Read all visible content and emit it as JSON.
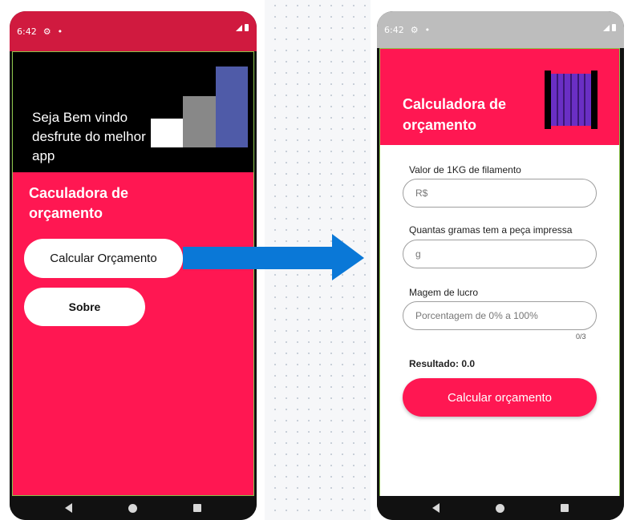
{
  "screen1": {
    "status_time": "6:42",
    "welcome": "Seja Bem vindo desfrute do melhor app",
    "title": "Caculadora de orçamento",
    "buttons": {
      "calc": "Calcular Orçamento",
      "sobre": "Sobre"
    }
  },
  "screen2": {
    "status_time": "6:42",
    "title": "Calculadora de orçamento",
    "fields": {
      "valor": {
        "label": "Valor de 1KG de filamento",
        "placeholder": "R$"
      },
      "gramas": {
        "label": "Quantas gramas tem a peça impressa",
        "placeholder": "g"
      },
      "lucro": {
        "label": "Magem de lucro",
        "placeholder": "Porcentagem de 0% a 100%",
        "counter": "0/3"
      }
    },
    "result": "Resultado: 0.0",
    "button": "Calcular orçamento"
  },
  "colors": {
    "primary": "#ff1752",
    "status_red": "#d01a3f",
    "arrow": "#0a78d7"
  }
}
